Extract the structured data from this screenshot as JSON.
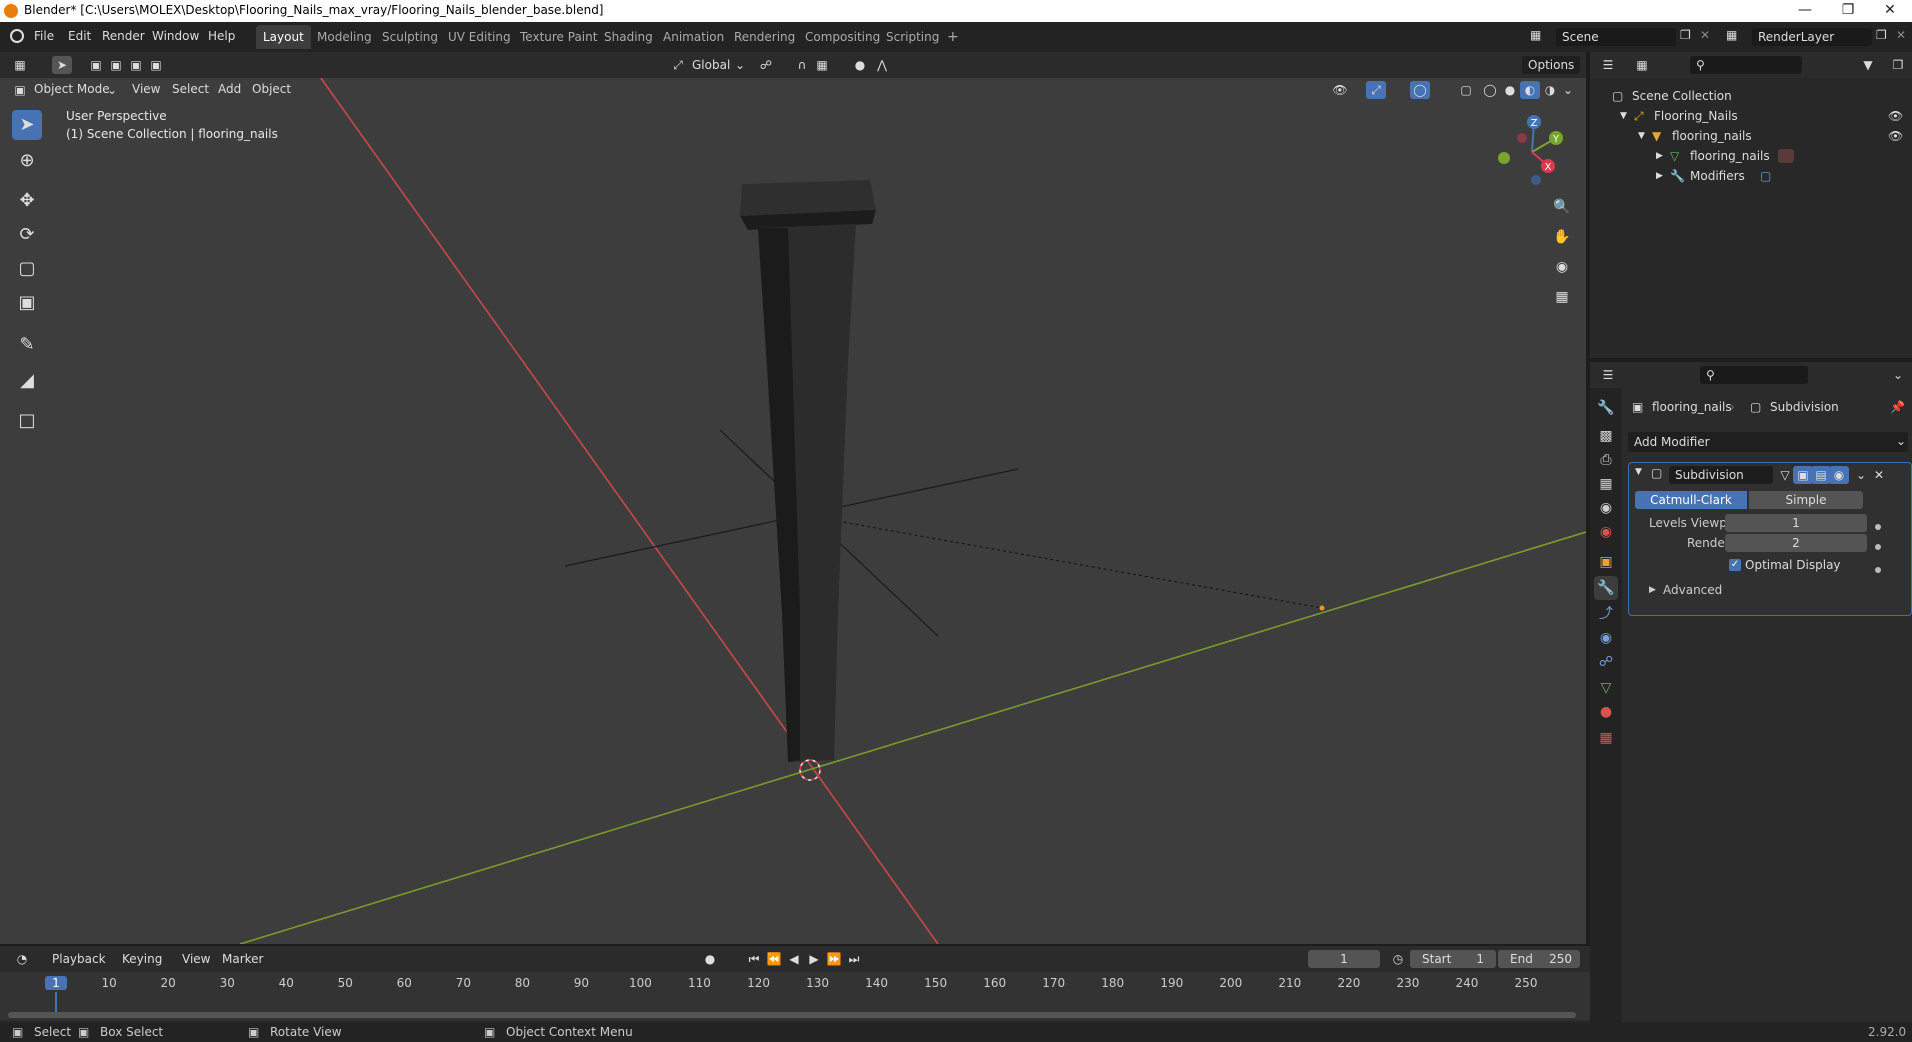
{
  "window": {
    "title": "Blender* [C:\\Users\\MOLEX\\Desktop\\Flooring_Nails_max_vray/Flooring_Nails_blender_base.blend]"
  },
  "menu": [
    "File",
    "Edit",
    "Render",
    "Window",
    "Help"
  ],
  "workspaces": [
    "Layout",
    "Modeling",
    "Sculpting",
    "UV Editing",
    "Texture Paint",
    "Shading",
    "Animation",
    "Rendering",
    "Compositing",
    "Scripting"
  ],
  "active_workspace": "Layout",
  "scene": {
    "name": "Scene",
    "view_layer": "RenderLayer"
  },
  "viewport_header": {
    "transform_orientation": "Global",
    "options_label": "Options",
    "mode": "Object Mode",
    "menus": [
      "View",
      "Select",
      "Add",
      "Object"
    ]
  },
  "viewport": {
    "perspective_label": "User Perspective",
    "collection_label": "(1) Scene Collection | flooring_nails",
    "gizmo_axes": [
      "Z",
      "Y",
      "X"
    ]
  },
  "outliner": {
    "root": "Scene Collection",
    "items": [
      {
        "label": "Flooring_Nails"
      },
      {
        "label": "flooring_nails"
      },
      {
        "label": "flooring_nails"
      },
      {
        "label": "Modifiers"
      }
    ]
  },
  "properties": {
    "object_name": "flooring_nails",
    "modifier_context": "Subdivision",
    "add_modifier_label": "Add Modifier",
    "modifier": {
      "name": "Subdivision",
      "algorithms": [
        "Catmull-Clark",
        "Simple"
      ],
      "active_algorithm": "Catmull-Clark",
      "levels_viewport_label": "Levels Viewport",
      "levels_viewport_value": "1",
      "render_label": "Render",
      "render_value": "2",
      "optimal_display_label": "Optimal Display",
      "optimal_display_checked": true,
      "advanced_label": "Advanced"
    }
  },
  "timeline": {
    "menus": [
      "Playback",
      "Keying",
      "View",
      "Marker"
    ],
    "current_frame": "1",
    "start_label": "Start",
    "start_value": "1",
    "end_label": "End",
    "end_value": "250",
    "ticks": [
      "1",
      "10",
      "20",
      "30",
      "40",
      "50",
      "60",
      "70",
      "80",
      "90",
      "100",
      "110",
      "120",
      "130",
      "140",
      "150",
      "160",
      "170",
      "180",
      "190",
      "200",
      "210",
      "220",
      "230",
      "240",
      "250"
    ]
  },
  "statusbar": {
    "select": "Select",
    "box_select": "Box Select",
    "rotate_view": "Rotate View",
    "context_menu": "Object Context Menu",
    "version": "2.92.0"
  }
}
